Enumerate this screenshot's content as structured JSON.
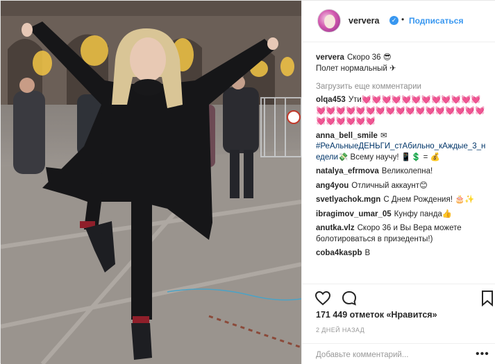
{
  "post": {
    "username": "ververa",
    "follow_label": "Подписаться",
    "dot": "•",
    "verified_glyph": "✓",
    "caption": "Скоро 36 😎",
    "caption_line2": "Полет нормальный ✈",
    "load_more": "Загрузить еще комментарии",
    "comments": [
      {
        "user": "olqa453",
        "text": "Ути💓💓💓💓💓💓💓💓💓💓💓💓💓💓💓💓💓💓💓💓💓💓💓💓💓💓💓💓💓💓💓💓💓💓💓"
      },
      {
        "user": "anna_bell_smile",
        "text": "✉",
        "tag": "#РеАльныеДЕНЬГИ_стАбильно_кАждые_3_недели💸",
        "after": " Всему научу! 📱💲 = 💰"
      },
      {
        "user": "natalya_efrmova",
        "text": "Великолепна!"
      },
      {
        "user": "ang4you",
        "text": "Отличный аккаунт😊"
      },
      {
        "user": "svetlyachok.mgn",
        "text": "С Днем Рождения! 🎂✨"
      },
      {
        "user": "ibragimov_umar_05",
        "text": "Кунфу панда👍"
      },
      {
        "user": "anutka.vlz",
        "text": "Скоро 36 и Вы Вера можете болотироваться в призеденты!)"
      },
      {
        "user": "coba4kaspb",
        "text": "В"
      }
    ],
    "likes": "171 449 отметок «Нравится»",
    "time": "2 ДНЕЙ НАЗАД",
    "comment_placeholder": "Добавьте комментарий...",
    "more_label": "•••"
  },
  "icons": {
    "like": "heart-icon",
    "comment": "comment-bubble-icon",
    "save": "bookmark-icon"
  },
  "colors": {
    "link": "#3897f0",
    "text": "#262626",
    "muted": "#8e8e8e",
    "border": "#efefef"
  }
}
